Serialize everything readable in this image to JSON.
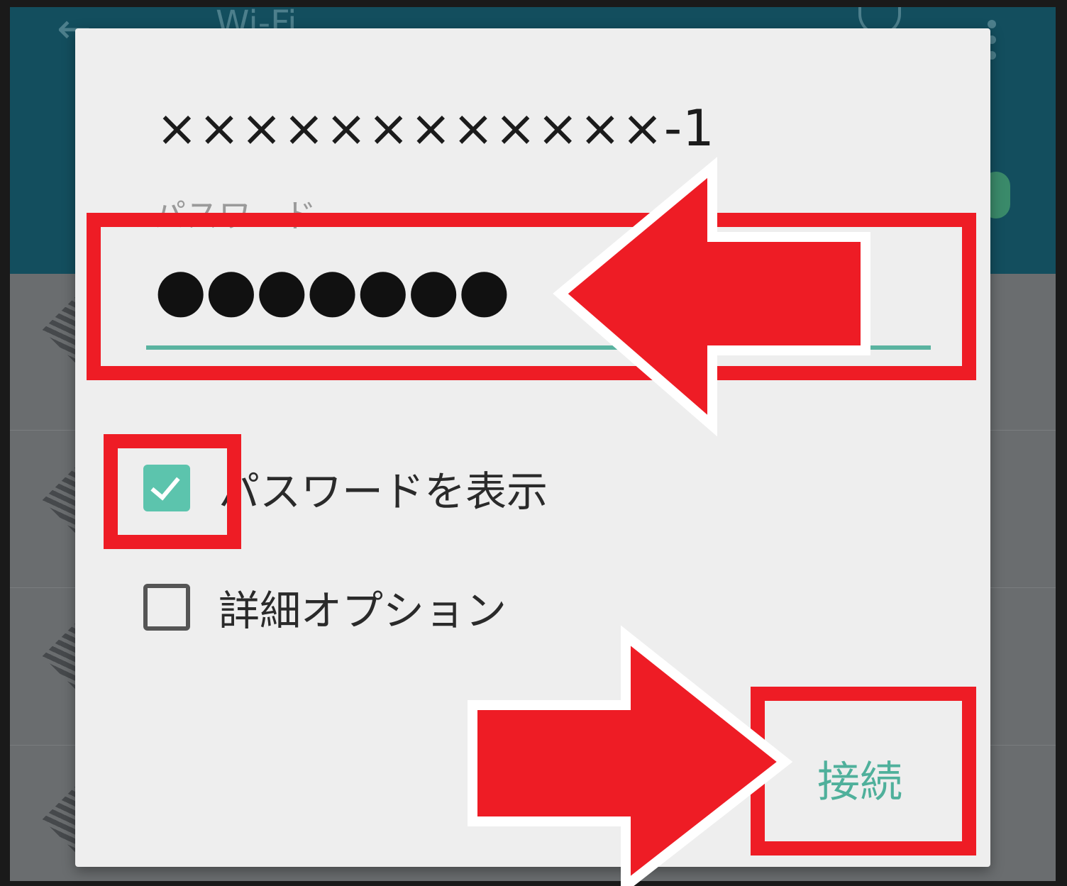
{
  "background": {
    "appbar_title": "Wi-Fi",
    "back_icon": "arrow-left-icon",
    "power_icon": "power-icon",
    "more_icon": "more-vert-icon"
  },
  "dialog": {
    "network_name": "××××××××××××-1",
    "password_label": "パスワード",
    "password_value": "●●●●●●●",
    "show_password": {
      "label": "パスワードを表示",
      "checked": true
    },
    "advanced_options": {
      "label": "詳細オプション",
      "checked": false
    },
    "connect_label": "接続"
  },
  "colors": {
    "annotation_red": "#ee1c25",
    "accent_teal": "#5cc4ad",
    "appbar": "#134e5e",
    "dialog_bg": "#eeeeee"
  }
}
